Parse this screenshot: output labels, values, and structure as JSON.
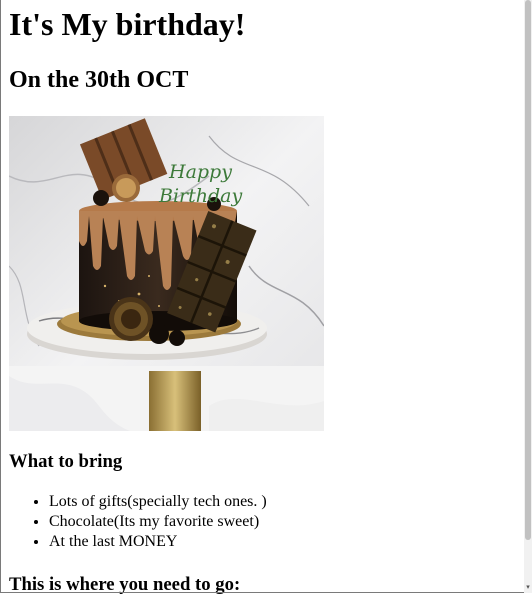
{
  "page": {
    "title": "It's My birthday!",
    "subtitle": "On the 30th OCT",
    "image": {
      "alt": "Chocolate birthday cake with Happy Birthday topper"
    },
    "bring_heading": "What to bring",
    "bring_items": [
      "Lots of gifts(specially tech ones. )",
      "Chocolate(Its my favorite sweet)",
      "At the last MONEY"
    ],
    "directions_heading": "This is where you need to go:"
  },
  "scrollbar": {
    "icon": "chevron-down-icon"
  }
}
